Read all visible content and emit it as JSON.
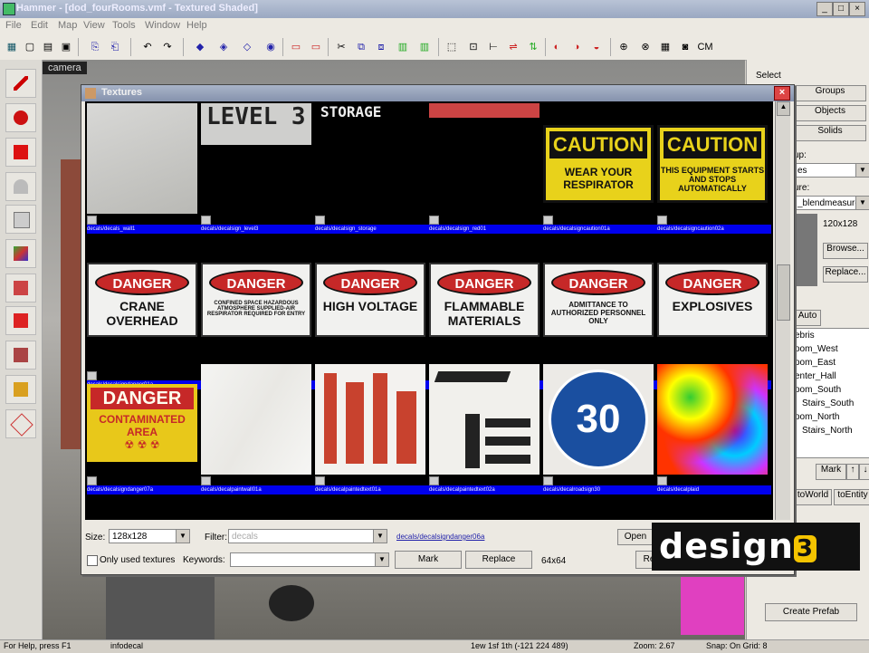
{
  "window": {
    "title": "Hammer - [dod_fourRooms.vmf - Textured Shaded]",
    "min": "_",
    "max": "□",
    "close": "×"
  },
  "menu": [
    "File",
    "Edit",
    "Map",
    "View",
    "Tools",
    "Window",
    "Help"
  ],
  "viewport": {
    "label": "camera"
  },
  "right_panel": {
    "select_label": "Select",
    "groups_btn": "Groups",
    "objects_btn": "Objects",
    "solids_btn": "Solids",
    "group_label": "up:",
    "group_value": "es",
    "texture_label": "ure:",
    "texture_value": "_blendmeasure",
    "size": "120x128",
    "browse_btn": "Browse...",
    "replace_btn": "Replace...",
    "auto_btn": "Auto",
    "vis_items": [
      "ebris",
      "oom_West",
      "oom_East",
      "enter_Hall",
      "oom_South",
      "Stairs_South",
      "oom_North",
      "Stairs_North"
    ],
    "mark_btn": "Mark",
    "toworld_btn": "toWorld",
    "toentity_btn": "toEntity",
    "create_prefab_btn": "Create Prefab"
  },
  "dialog": {
    "title": "Textures",
    "rows": [
      [
        {
          "kind": "tex",
          "text": "",
          "filename": "decals/decals_wall1"
        },
        {
          "kind": "tex",
          "text": "LEVEL 3",
          "filename": "decals/decalsign_level3"
        },
        {
          "kind": "tex",
          "text": "STORAGE",
          "filename": "decals/decalsign_storage"
        },
        {
          "kind": "tex",
          "text": "",
          "filename": "decals/decalsign_red01"
        },
        {
          "kind": "caution",
          "text": "CAUTION",
          "sub": "WEAR YOUR RESPIRATOR",
          "filename": "decals/decalsigncaution01a"
        },
        {
          "kind": "caution",
          "text": "CAUTION",
          "sub": "THIS EQUIPMENT STARTS AND STOPS AUTOMATICALLY",
          "filename": "decals/decalsigncaution02a"
        }
      ],
      [
        {
          "kind": "danger",
          "text": "DANGER",
          "sub": "CRANE OVERHEAD",
          "filename": "decals/decalsigndanger01a"
        },
        {
          "kind": "danger",
          "text": "DANGER",
          "sub": "CONFINED SPACE HAZARDOUS ATMOSPHERE SUPPLIED-AIR RESPIRATOR REQUIRED FOR ENTRY",
          "filename": "decals/decalsigndanger02a"
        },
        {
          "kind": "danger",
          "text": "DANGER",
          "sub": "HIGH VOLTAGE",
          "filename": "decals/decalsigndanger03a"
        },
        {
          "kind": "danger",
          "text": "DANGER",
          "sub": "FLAMMABLE MATERIALS",
          "filename": "decals/decalsigndanger04a"
        },
        {
          "kind": "danger",
          "text": "DANGER",
          "sub": "ADMITTANCE TO AUTHORIZED PERSONNEL ONLY",
          "filename": "decals/decalsigndanger05a"
        },
        {
          "kind": "danger",
          "text": "DANGER",
          "sub": "EXPLOSIVES",
          "filename": "decals/decalsigndanger06a"
        }
      ],
      [
        {
          "kind": "contam",
          "text": "DANGER",
          "sub": "CONTAMINATED AREA",
          "filename": "decals/decalsigndanger07a"
        },
        {
          "kind": "white",
          "text": "",
          "filename": "decals/decalpaintwall01a"
        },
        {
          "kind": "paint",
          "text": "",
          "filename": "decals/decalpaintedtext01a"
        },
        {
          "kind": "stencil",
          "text": "",
          "filename": "decals/decalpaintedtext02a"
        },
        {
          "kind": "speed",
          "text": "30",
          "filename": "decals/decalroadsign30"
        },
        {
          "kind": "rainbow",
          "text": "",
          "filename": "decals/decalplaid"
        }
      ]
    ],
    "size_label": "Size:",
    "size_value": "128x128",
    "filter_label": "Filter:",
    "filter_value": "decals",
    "selected_texture": "decals/decalsigndanger06a",
    "only_used_label": "Only used textures",
    "keywords_label": "Keywords:",
    "keywords_value": "",
    "mark_btn": "Mark",
    "replace_btn": "Replace",
    "dims": "64x64",
    "open_btn": "Open",
    "re_btn": "Re"
  },
  "status": {
    "help": "For Help, press F1",
    "selection": "infodecal",
    "coords": "1ew 1sf 1th (-121 224 489)",
    "zoom": "Zoom: 2.67",
    "snap": "Snap: On Grid: 8"
  },
  "watermark": {
    "text": "design3",
    "brand_color": "#f5c400"
  },
  "colors": {
    "filename_bar": "#0000ee",
    "danger_red": "#c62828",
    "caution_yellow": "#e8d21b"
  }
}
